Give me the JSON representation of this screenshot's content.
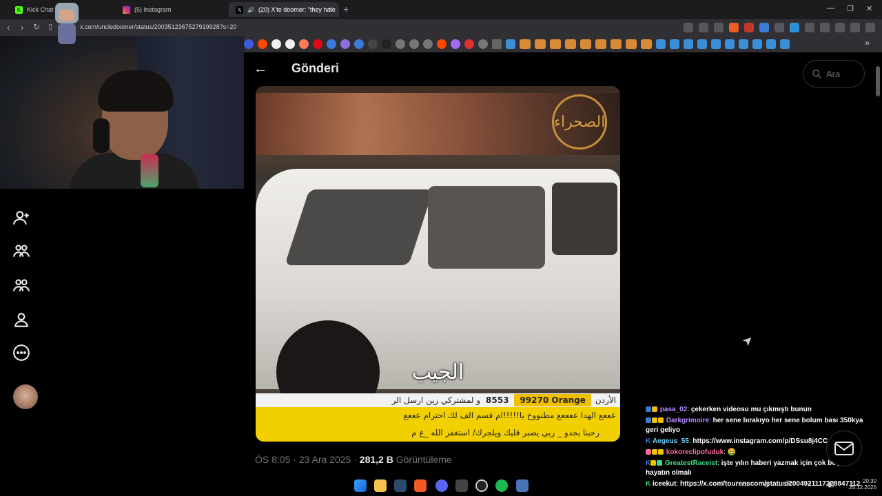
{
  "browser": {
    "tabs": [
      {
        "title": "Kick Chat Taki",
        "icon": "kick-icon"
      },
      {
        "title": "(5) Instagram",
        "icon": "instagram-icon"
      },
      {
        "title": "(20) X'te doomer: \"they hate",
        "icon": "x-icon",
        "active": true
      }
    ],
    "url": "x.com/uncledoomer/status/2003512367527919928?s=20"
  },
  "header": {
    "title": "Gönderi",
    "back_icon": "back-arrow-icon"
  },
  "search": {
    "placeholder": "Ara"
  },
  "leftnav": {
    "items": [
      {
        "name": "follow-icon"
      },
      {
        "name": "communities-icon"
      },
      {
        "name": "communities-icon"
      },
      {
        "name": "profile-icon"
      },
      {
        "name": "more-icon"
      }
    ]
  },
  "video": {
    "subtitle": "الجيب",
    "logo_text": "الصحراء",
    "ticker_top_country": "الأردن",
    "ticker_top_orange": "99270 Orange",
    "ticker_top_number": "8553",
    "ticker_top_text": "و لمشتركي زين ارسل الر",
    "ticker_mid_text": "عععع الهدا ععععع مطنووخ يا!!!!!ام قسم الف لك احترام عععع",
    "ticker_bot_text": "رحبنا بجدو _ ربي يصبر قلبك ويلجرك/ استغفر الله _غ م"
  },
  "post": {
    "time": "ÖS 8:05",
    "date": "23 Ara 2025",
    "views": "281,2 B",
    "views_label": "Görüntüleme",
    "separator": "·"
  },
  "chat": {
    "messages": [
      {
        "user": "pasa_02",
        "text": "çekerken videosu mu çıkmıştı bunun",
        "color": "#b48cff"
      },
      {
        "user": "Darkgrimoire",
        "text": "her sene bırakıyo her sene bolum bası 350kya geri geliyo",
        "color": "#b48cff"
      },
      {
        "user": "Aegeus_55",
        "text": "https://www.instagram.com/p/DSsu8j4CC_Q/",
        "color": "#6fd3ff"
      },
      {
        "user": "kokoreclipofuduk",
        "text": "🤮",
        "color": "#ff6b9a"
      },
      {
        "user": "GreatestRaceist",
        "text": "işte yılın haberi yazmak için çok boş bir hayatın olmalı",
        "color": "#3ddc84"
      },
      {
        "user": "iceekut",
        "text": "https://x.com/tourenscom/status/2004921117228847112",
        "color": "#ffffff"
      }
    ]
  },
  "taskbar": {
    "time": "20:30",
    "date": "23.12.2025"
  }
}
